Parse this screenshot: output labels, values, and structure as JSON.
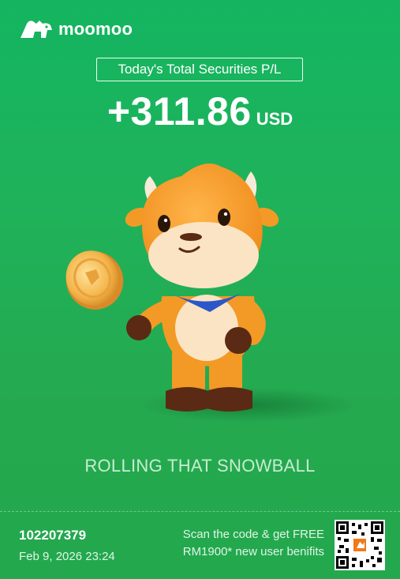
{
  "brand": {
    "name": "moomoo",
    "accent_color": "#1fb25a"
  },
  "pnl": {
    "label": "Today's Total Securities P/L",
    "value": "+311.86",
    "currency": "USD"
  },
  "illustration": {
    "icon": "bull-mascot-holding-coin"
  },
  "slogan": "ROLLING THAT SNOWBALL",
  "footer": {
    "user_id": "102207379",
    "datetime": "Feb 9, 2026 23:24",
    "promo_line1": "Scan the code & get FREE",
    "promo_line2": "RM1900* new user benifits",
    "qr_icon": "qr-code-icon"
  }
}
